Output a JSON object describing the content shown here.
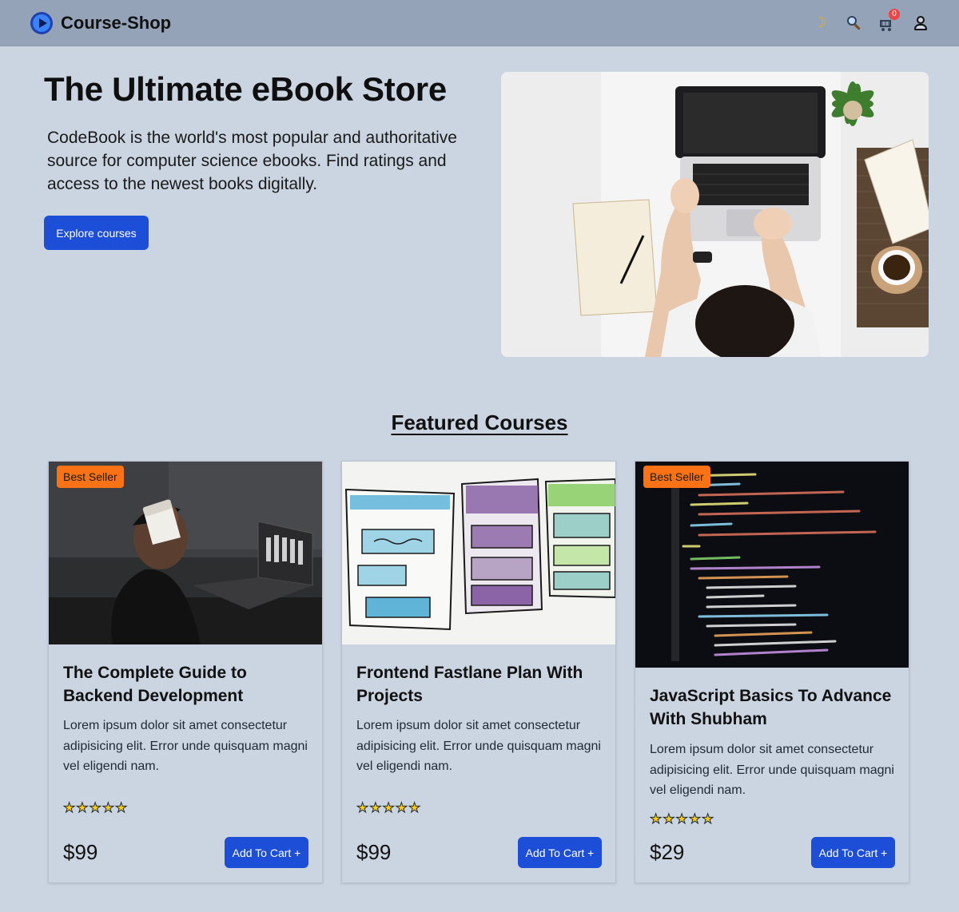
{
  "navbar": {
    "brand": "Course-Shop",
    "icons": [
      "moon-icon",
      "search-icon",
      "cart-icon",
      "user-icon"
    ],
    "cart_count": "0"
  },
  "hero": {
    "title": "The Ultimate eBook Store",
    "text": "CodeBook is the world's most popular and authoritative source for computer science ebooks. Find ratings and access to the newest books digitally.",
    "button": "Explore courses"
  },
  "featured": {
    "title": "Featured Courses",
    "cards": [
      {
        "badge": "Best Seller",
        "title": "The Complete Guide to Backend Development",
        "desc": "Lorem ipsum dolor sit amet consectetur adipisicing elit. Error unde quisquam magni vel eligendi nam.",
        "rating": 5,
        "price": "$99",
        "button": "Add To Cart +"
      },
      {
        "badge": "",
        "title": "Frontend Fastlane Plan With Projects",
        "desc": "Lorem ipsum dolor sit amet consectetur adipisicing elit. Error unde quisquam magni vel eligendi nam.",
        "rating": 5,
        "price": "$99",
        "button": "Add To Cart +"
      },
      {
        "badge": "Best Seller",
        "title": "JavaScript Basics To Advance With Shubham",
        "desc": "Lorem ipsum dolor sit amet consectetur adipisicing elit. Error unde quisquam magni vel eligendi nam.",
        "rating": 5,
        "price": "$29",
        "button": "Add To Cart +"
      }
    ]
  },
  "colors": {
    "page_bg": "#cbd5e1",
    "navbar_bg": "#94a3b8",
    "primary": "#1d4ed8",
    "badge": "#f97316",
    "star": "#facc15"
  }
}
